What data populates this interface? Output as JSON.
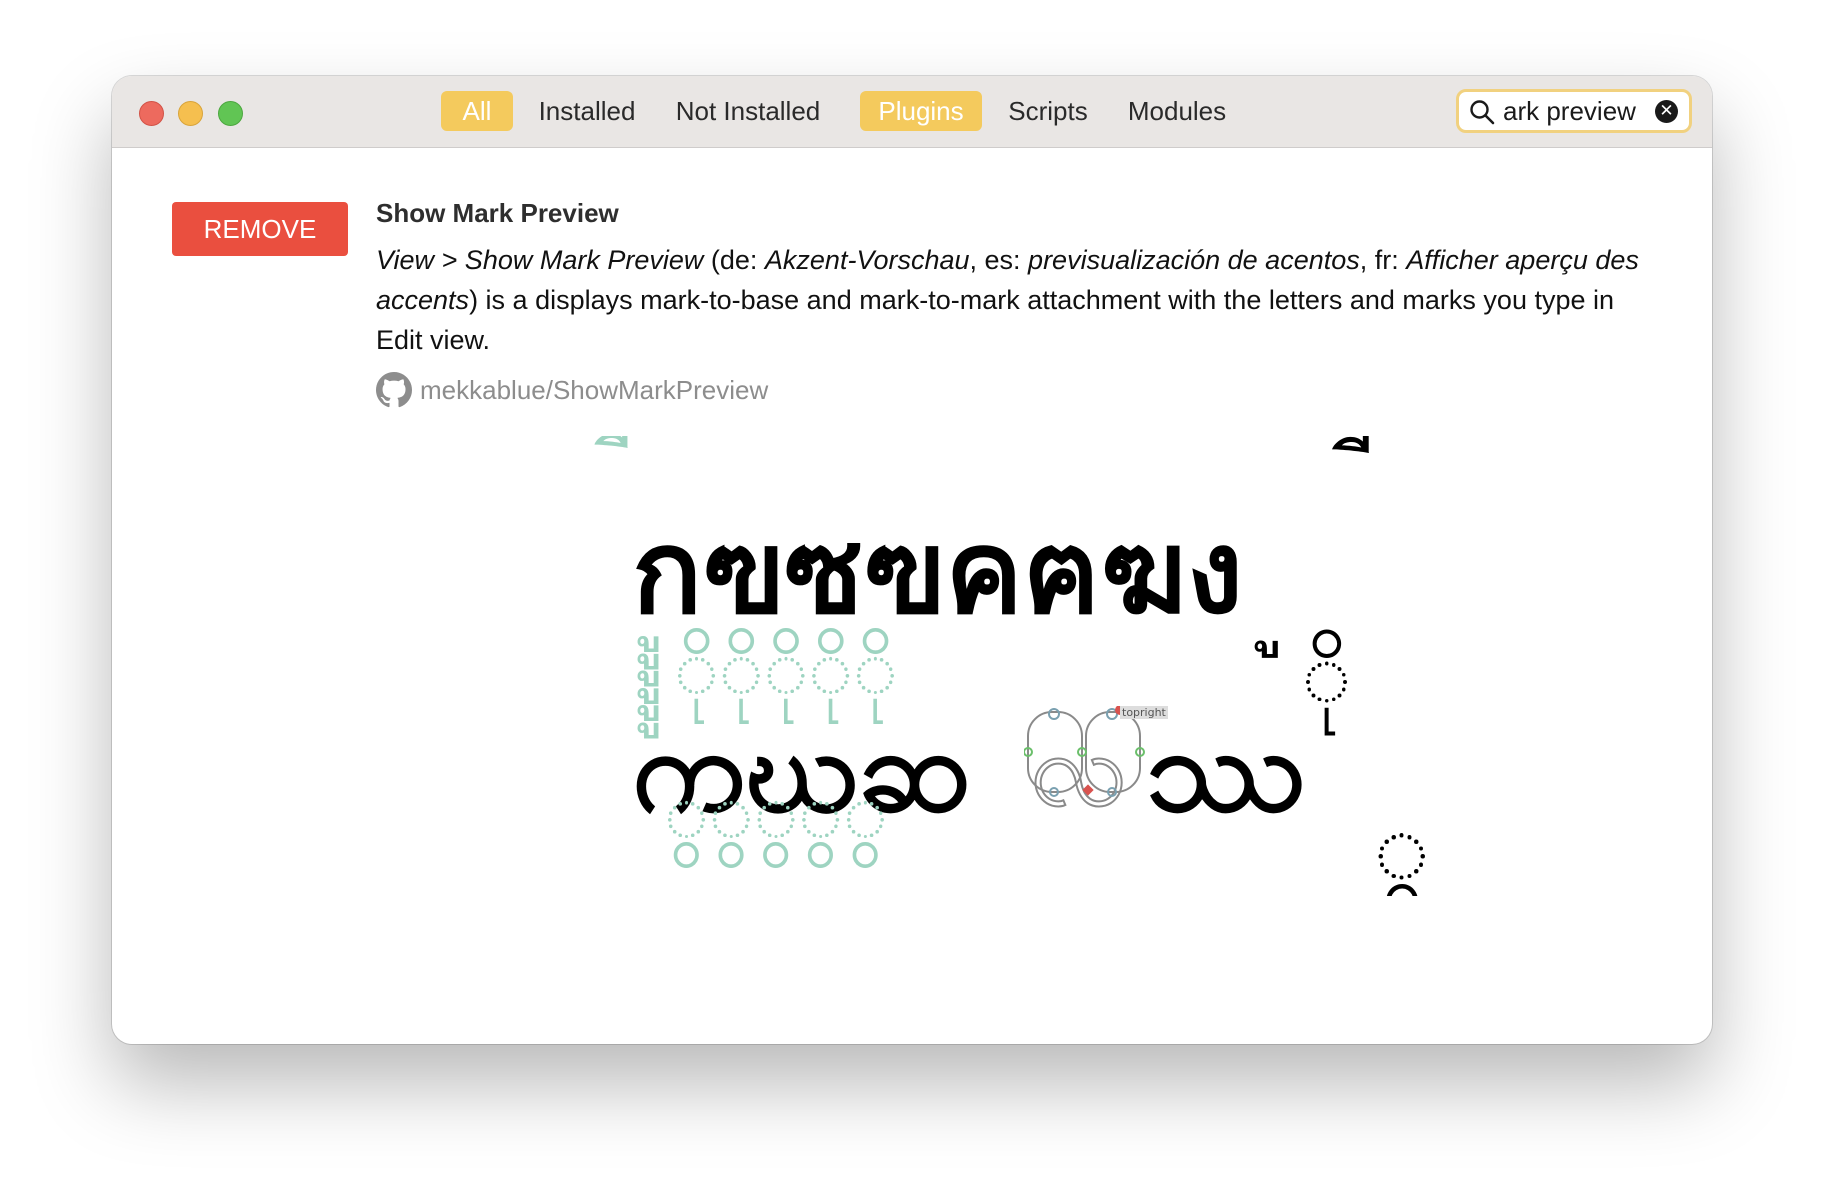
{
  "toolbar": {
    "type_tabs": [
      "All",
      "Installed",
      "Not Installed"
    ],
    "category_tabs": [
      "Plugins",
      "Scripts",
      "Modules"
    ],
    "search": {
      "value": "ark preview",
      "clear_icon": "close-circle-icon"
    },
    "colors": {
      "active_tab": "#f4ca5d",
      "search_border": "#f1d17f"
    }
  },
  "plugin": {
    "action_label": "REMOVE",
    "action_color": "#ea4f3f",
    "title": "Show Mark Preview",
    "description": {
      "menu_path": "View > Show Mark Preview",
      "de_prefix": " (de: ",
      "de": "Akzent-Vorschau",
      "es_prefix": ", es: ",
      "es": "previsualización de acentos",
      "fr_prefix": ", fr: ",
      "fr": "Afficher aperçu des accents",
      "body": ") is a displays mark-to-base and mark-to-mark attachment with the letters and marks you type in Edit view."
    },
    "repo": "mekkablue/ShowMarkPreview",
    "repo_icon": "github-icon"
  },
  "preview_image": {
    "row1_letters": "กฃซฃคฅฆง",
    "row1_marks_above": "ี้ี้ี้ี้ี้ี้ี้",
    "row1_marks_below": "ูููููู",
    "row1_spare_mark_above": "ี้",
    "row1_spare_mark_below": "ู",
    "row2_letters": "ကဃဆ",
    "row2_outlined_letter": "လ",
    "row2_last_letter": "ဿ",
    "row2_marks_above": "ိုိုိုိုို",
    "row2_marks_below": "ွွွွွ",
    "row2_spare_mark_above": "ို",
    "row2_spare_mark_below": "ွ",
    "outline_label": "topright",
    "colors": {
      "mark": "#9ed4c1",
      "selected_mark": "#f4d768",
      "letter": "#000000"
    }
  }
}
